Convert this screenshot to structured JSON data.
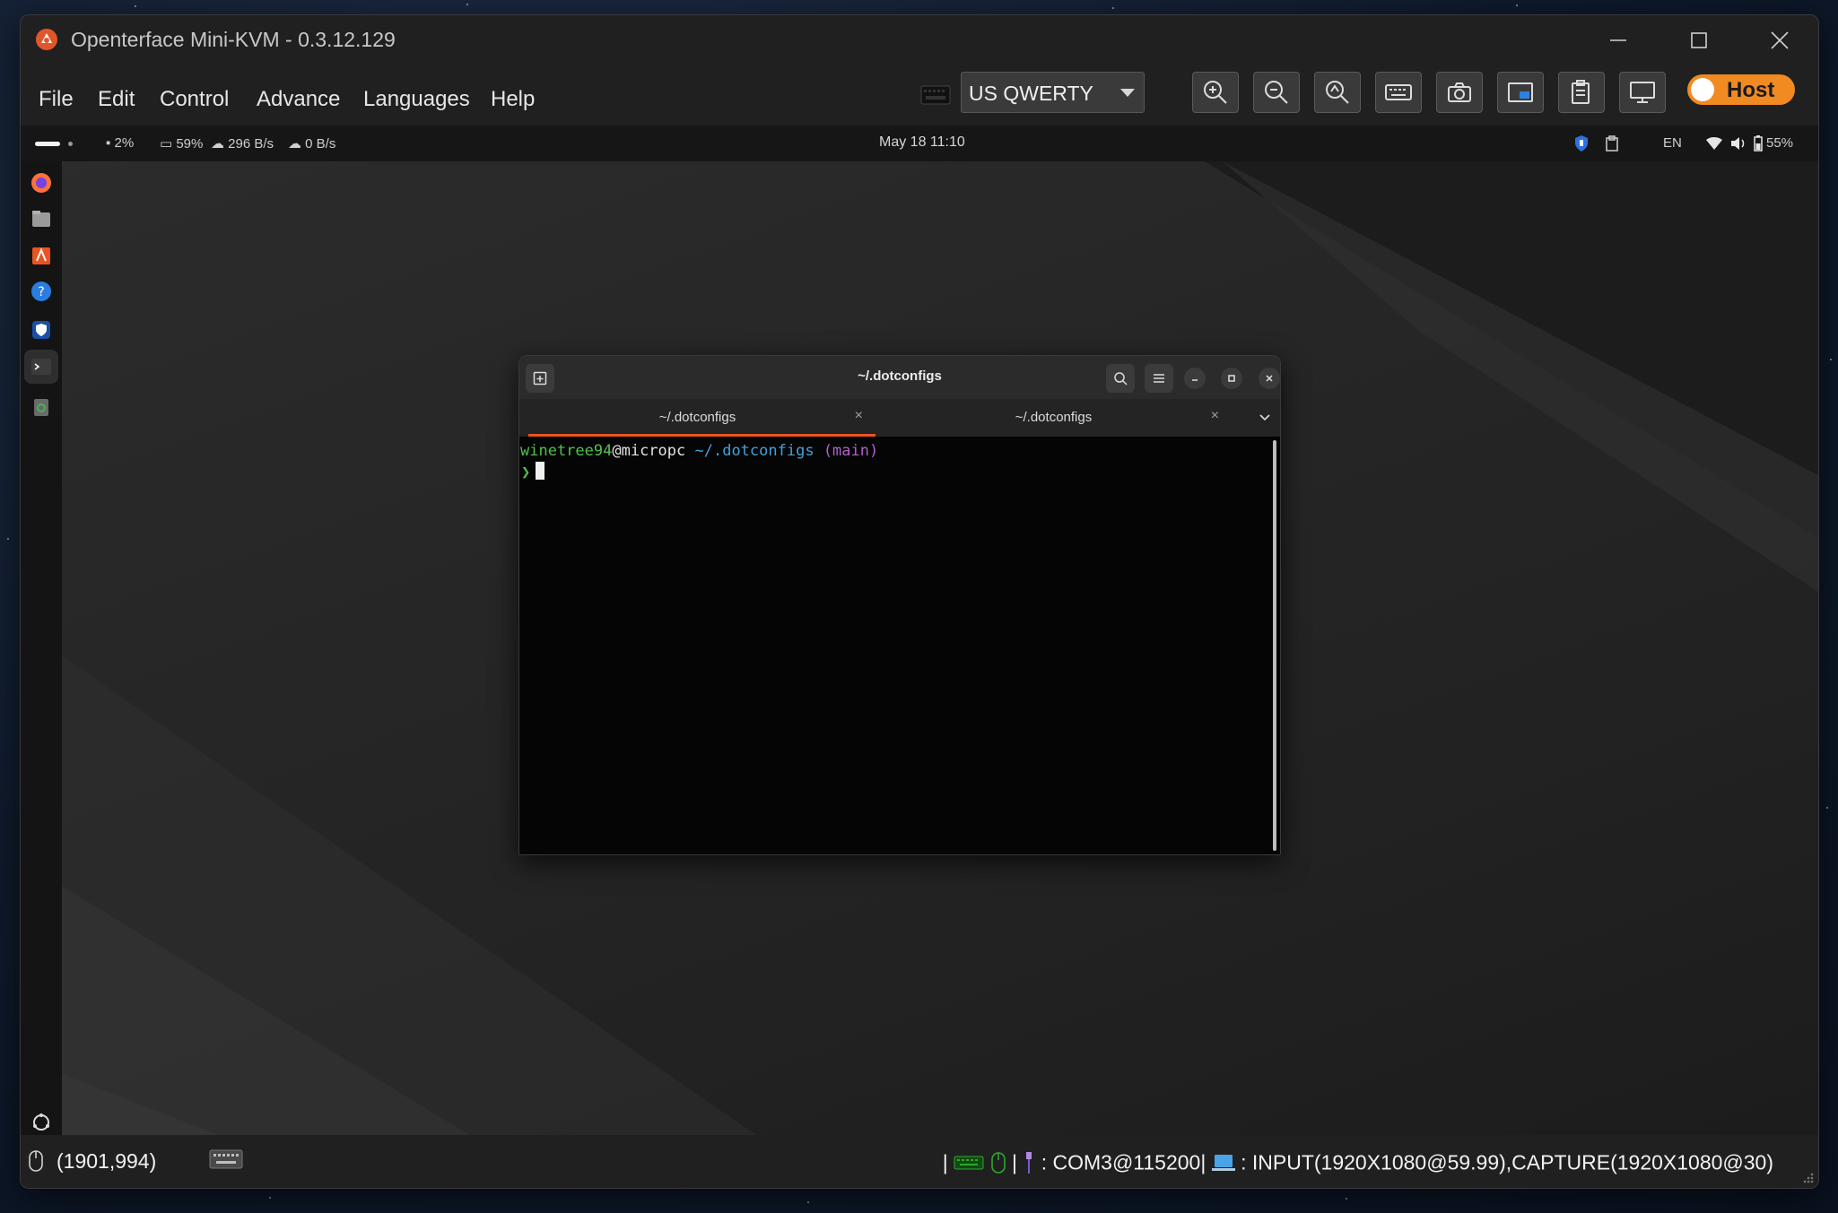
{
  "window": {
    "title": "Openterface Mini-KVM - 0.3.12.129"
  },
  "menu": [
    "File",
    "Edit",
    "Control",
    "Advance",
    "Languages",
    "Help"
  ],
  "toolbar": {
    "keyboard_layout": "US QWERTY",
    "buttons": [
      "zoom-in-icon",
      "zoom-out-icon",
      "zoom-reset-icon",
      "keyboard-icon",
      "camera-icon",
      "picture-in-picture-icon",
      "clipboard-icon",
      "monitor-icon"
    ],
    "host_toggle": "Host",
    "accent": "#f18a21"
  },
  "remote": {
    "topbar": {
      "disk": "2%",
      "memory": "59%",
      "upload": "296 B/s",
      "download": "0 B/s",
      "clock": "May 18  11:10",
      "lang": "EN",
      "battery": "55%"
    },
    "terminal": {
      "title": "~/.dotconfigs",
      "tabs": [
        {
          "label": "~/.dotconfigs",
          "active": true
        },
        {
          "label": "~/.dotconfigs",
          "active": false
        }
      ],
      "prompt": {
        "user": "winetree94",
        "at_host": "@micropc",
        "path": "~/.dotconfigs",
        "branch": "(main)",
        "symbol": "❯"
      }
    }
  },
  "status": {
    "coords": "(1901,994)",
    "divider": "|",
    "port": ": COM3@115200|",
    "video": ": INPUT(1920X1080@59.99),CAPTURE(1920X1080@30)"
  }
}
